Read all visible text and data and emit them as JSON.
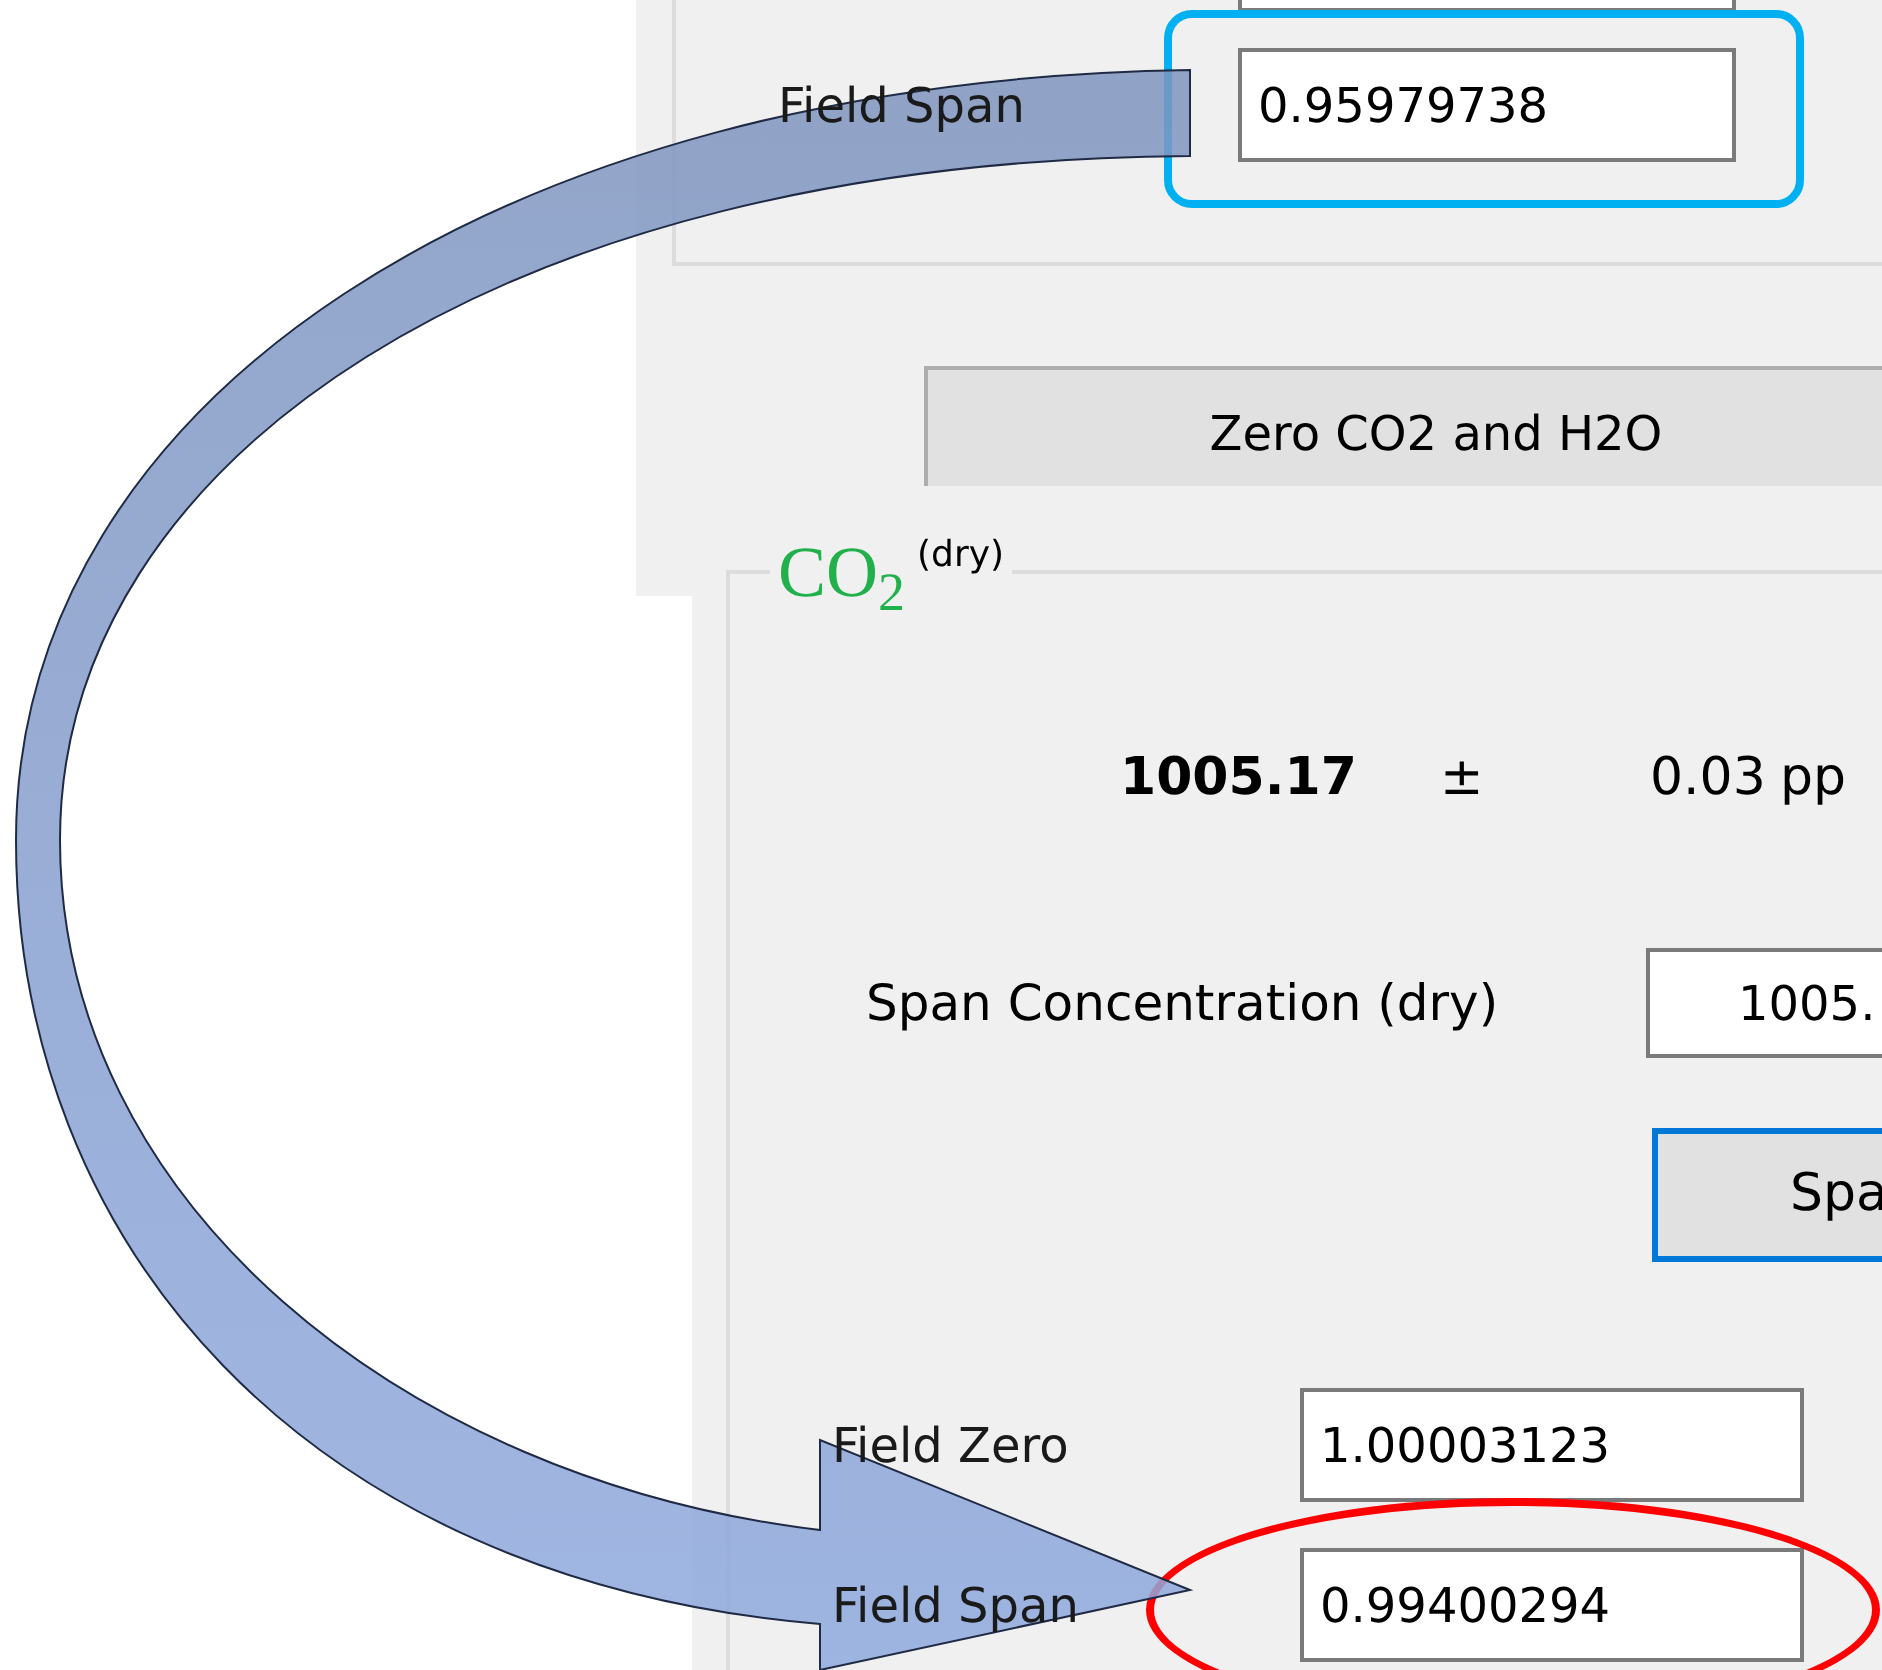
{
  "top_panel": {
    "field_span": {
      "label": "Field Span",
      "value": "0.95979738",
      "boxed": true
    },
    "button": "Zero CO2 and H2O"
  },
  "co2_panel": {
    "legend": "CO$_{2}$",
    "legend_note": "(dry)",
    "reading": "1005.17",
    "plus_minus": "±",
    "uncertainty": "0.03",
    "unit": "pp",
    "span_concentration": {
      "label": "Span Concentration (dry)",
      "value": "1005."
    },
    "span_button": {
      "label": "Spa",
      "focused": true
    },
    "fields": [
      {
        "label": "Field Zero",
        "value": "1.00003123",
        "circled": false
      },
      {
        "label": "Field Span",
        "value": "0.99400294",
        "circled": true
      }
    ]
  }
}
